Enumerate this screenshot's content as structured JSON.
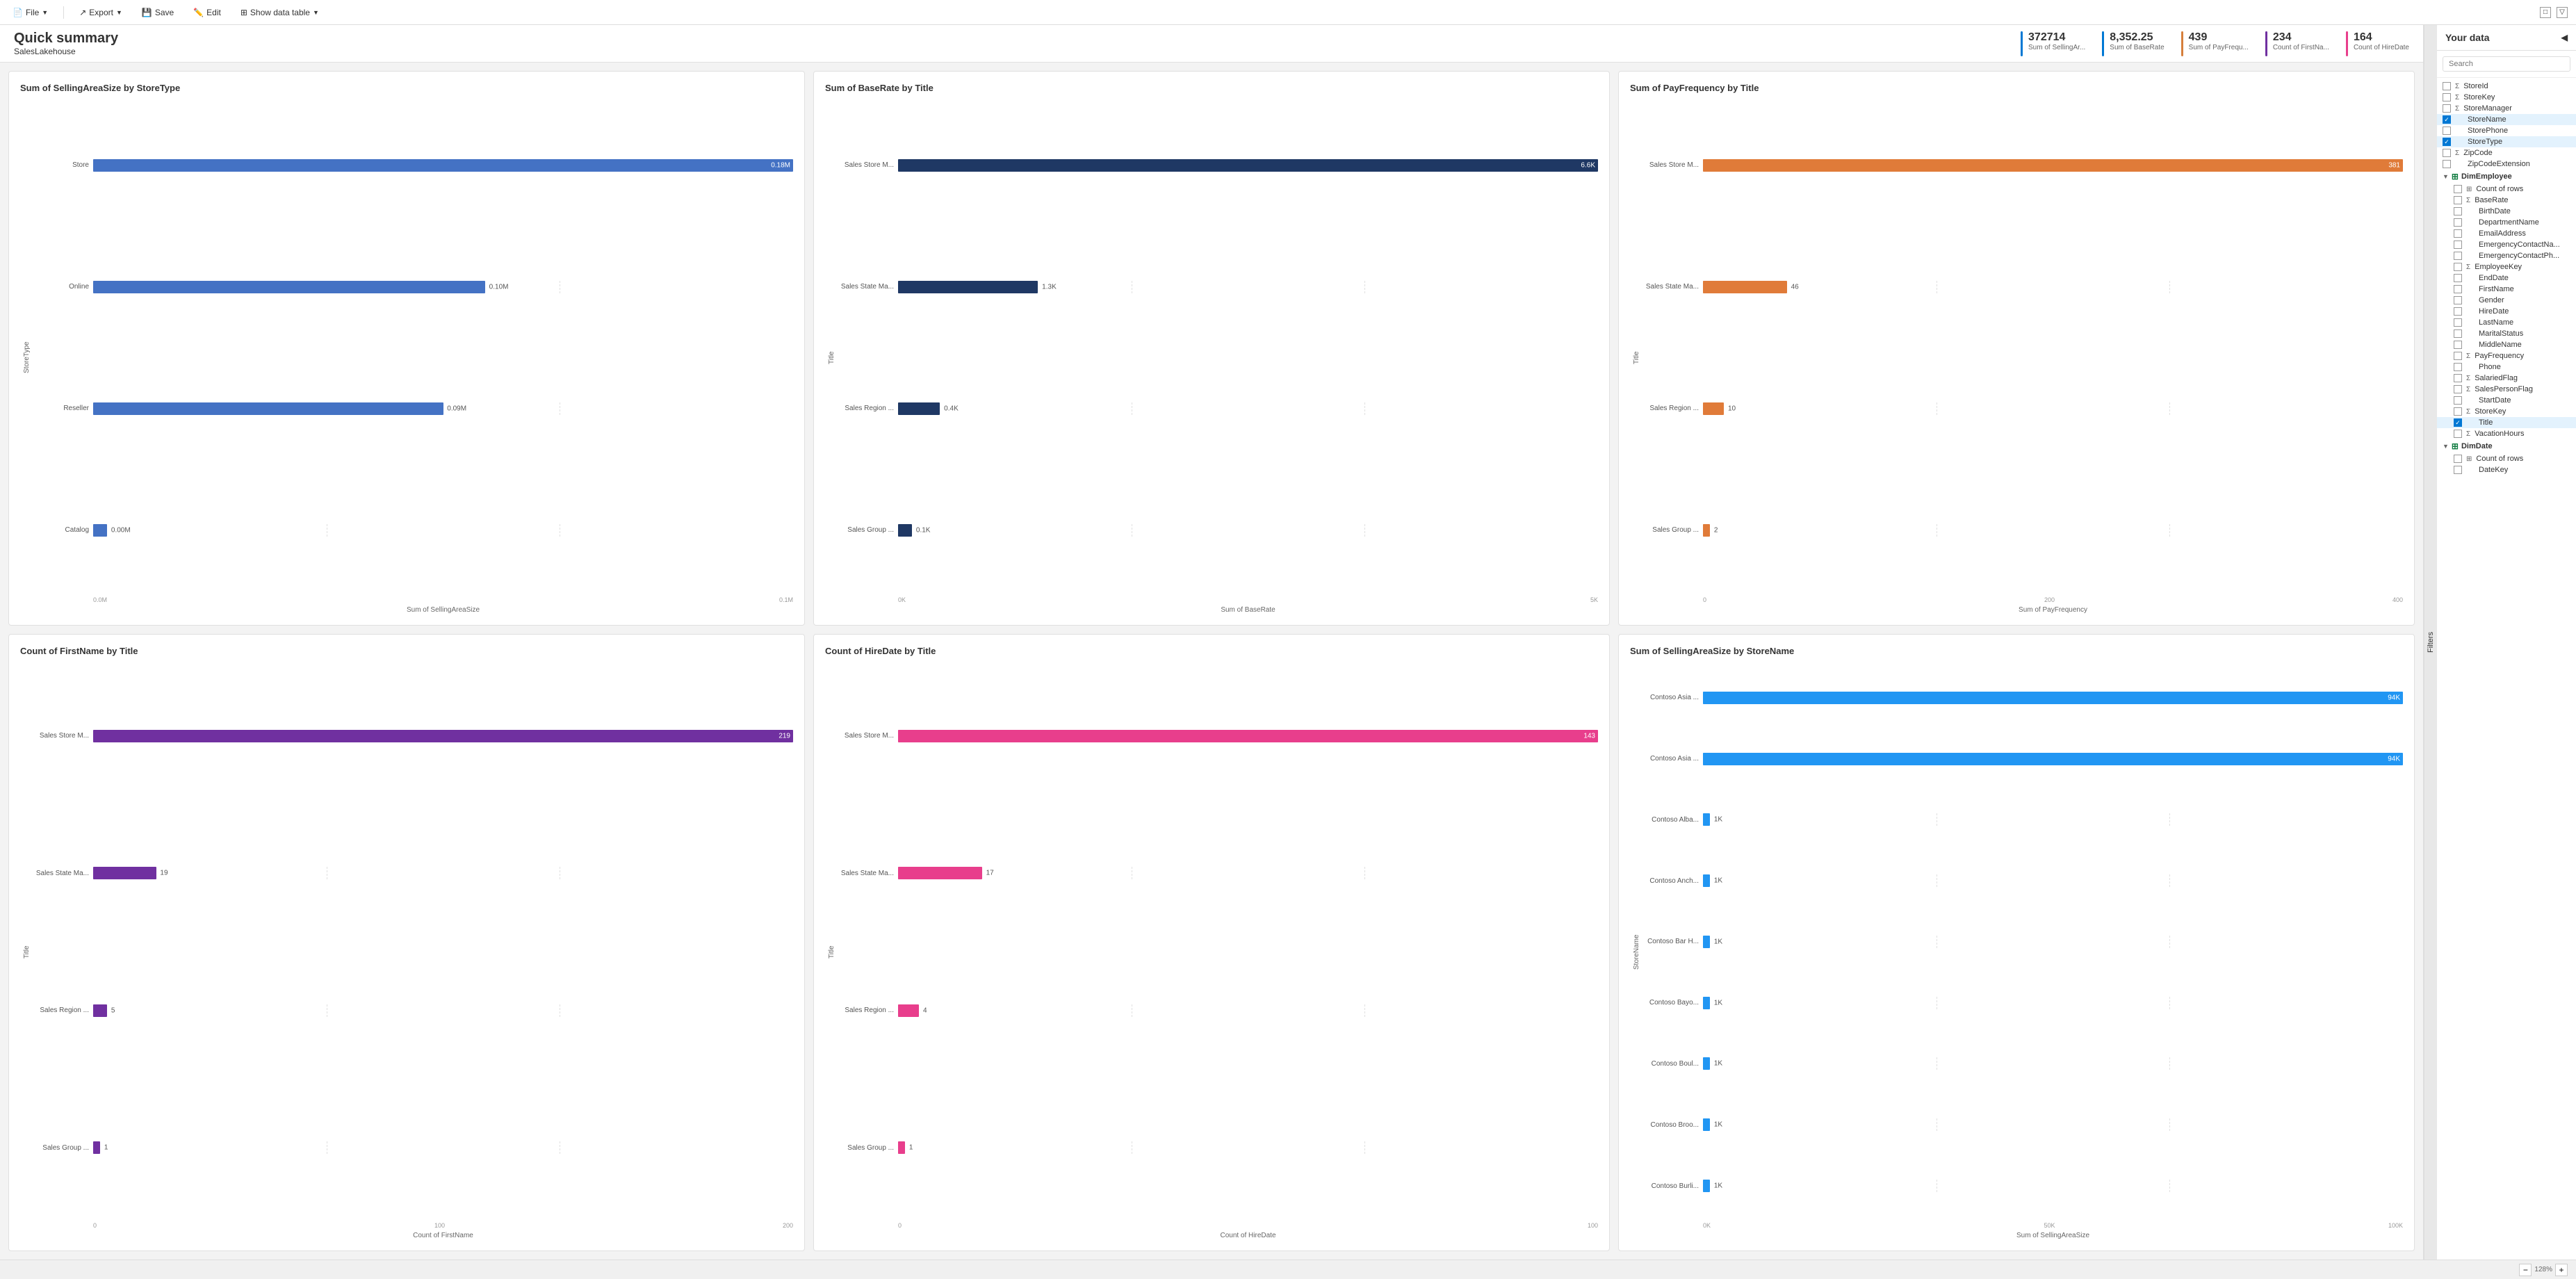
{
  "toolbar": {
    "file_label": "File",
    "export_label": "Export",
    "save_label": "Save",
    "edit_label": "Edit",
    "show_data_table_label": "Show data table"
  },
  "summary": {
    "title": "Quick summary",
    "subtitle": "SalesLakehouse",
    "kpis": [
      {
        "value": "372714",
        "label": "Sum of SellingAr...",
        "color": "#0078d4"
      },
      {
        "value": "8,352.25",
        "label": "Sum of BaseRate",
        "color": "#0078d4"
      },
      {
        "value": "439",
        "label": "Sum of PayFrequ...",
        "color": "#d67f3c"
      },
      {
        "value": "234",
        "label": "Count of FirstNa...",
        "color": "#7030a0"
      },
      {
        "value": "164",
        "label": "Count of HireDate",
        "color": "#e83e8c"
      }
    ]
  },
  "charts": [
    {
      "id": "chart1",
      "title": "Sum of SellingAreaSize by StoreType",
      "y_axis_label": "StoreType",
      "x_axis_label": "Sum of SellingAreaSize",
      "color": "#4472c4",
      "x_ticks": [
        "0.0M",
        "0.1M"
      ],
      "bars": [
        {
          "label": "Store",
          "value": "0.18M",
          "pct": 100
        },
        {
          "label": "Online",
          "value": "0.10M",
          "pct": 56
        },
        {
          "label": "Reseller",
          "value": "0.09M",
          "pct": 50
        },
        {
          "label": "Catalog",
          "value": "0.00M",
          "pct": 2
        }
      ]
    },
    {
      "id": "chart2",
      "title": "Sum of BaseRate by Title",
      "y_axis_label": "Title",
      "x_axis_label": "Sum of BaseRate",
      "color": "#1f3864",
      "x_ticks": [
        "0K",
        "5K"
      ],
      "bars": [
        {
          "label": "Sales Store M...",
          "value": "6.6K",
          "pct": 100
        },
        {
          "label": "Sales State Ma...",
          "value": "1.3K",
          "pct": 20
        },
        {
          "label": "Sales Region ...",
          "value": "0.4K",
          "pct": 6
        },
        {
          "label": "Sales Group ...",
          "value": "0.1K",
          "pct": 2
        }
      ]
    },
    {
      "id": "chart3",
      "title": "Sum of PayFrequency by Title",
      "y_axis_label": "Title",
      "x_axis_label": "Sum of PayFrequency",
      "color": "#e07b39",
      "x_ticks": [
        "0",
        "200",
        "400"
      ],
      "bars": [
        {
          "label": "Sales Store M...",
          "value": "381",
          "pct": 100
        },
        {
          "label": "Sales State Ma...",
          "value": "46",
          "pct": 12
        },
        {
          "label": "Sales Region ...",
          "value": "10",
          "pct": 3
        },
        {
          "label": "Sales Group ...",
          "value": "2",
          "pct": 1
        }
      ]
    },
    {
      "id": "chart4",
      "title": "Count of FirstName by Title",
      "y_axis_label": "Title",
      "x_axis_label": "Count of FirstName",
      "color": "#7030a0",
      "x_ticks": [
        "0",
        "100",
        "200"
      ],
      "bars": [
        {
          "label": "Sales Store M...",
          "value": "219",
          "pct": 100
        },
        {
          "label": "Sales State Ma...",
          "value": "19",
          "pct": 9
        },
        {
          "label": "Sales Region ...",
          "value": "5",
          "pct": 2
        },
        {
          "label": "Sales Group ...",
          "value": "1",
          "pct": 1
        }
      ]
    },
    {
      "id": "chart5",
      "title": "Count of HireDate by Title",
      "y_axis_label": "Title",
      "x_axis_label": "Count of HireDate",
      "color": "#e83e8c",
      "x_ticks": [
        "0",
        "100"
      ],
      "bars": [
        {
          "label": "Sales Store M...",
          "value": "143",
          "pct": 100
        },
        {
          "label": "Sales State Ma...",
          "value": "17",
          "pct": 12
        },
        {
          "label": "Sales Region ...",
          "value": "4",
          "pct": 3
        },
        {
          "label": "Sales Group ...",
          "value": "1",
          "pct": 1
        }
      ]
    },
    {
      "id": "chart6",
      "title": "Sum of SellingAreaSize by StoreName",
      "y_axis_label": "StoreName",
      "x_axis_label": "Sum of SellingAreaSize",
      "color": "#2196f3",
      "x_ticks": [
        "0K",
        "50K",
        "100K"
      ],
      "bars": [
        {
          "label": "Contoso Asia ...",
          "value": "94K",
          "pct": 100
        },
        {
          "label": "Contoso Asia ...",
          "value": "94K",
          "pct": 100
        },
        {
          "label": "Contoso Alba...",
          "value": "1K",
          "pct": 1
        },
        {
          "label": "Contoso Anch...",
          "value": "1K",
          "pct": 1
        },
        {
          "label": "Contoso Bar H...",
          "value": "1K",
          "pct": 1
        },
        {
          "label": "Contoso Bayo...",
          "value": "1K",
          "pct": 1
        },
        {
          "label": "Contoso Boul...",
          "value": "1K",
          "pct": 1
        },
        {
          "label": "Contoso Broo...",
          "value": "1K",
          "pct": 1
        },
        {
          "label": "Contoso Burli...",
          "value": "1K",
          "pct": 1
        }
      ]
    }
  ],
  "sidebar": {
    "title": "Your data",
    "search_placeholder": "Search",
    "filters_tab": "Filters",
    "tree": [
      {
        "type": "item",
        "label": "StoreId",
        "icon": "sigma",
        "checked": false
      },
      {
        "type": "item",
        "label": "StoreKey",
        "icon": "sigma",
        "checked": false
      },
      {
        "type": "item",
        "label": "StoreManager",
        "icon": "sigma",
        "checked": false
      },
      {
        "type": "item",
        "label": "StoreName",
        "icon": null,
        "checked": true,
        "selected": true
      },
      {
        "type": "item",
        "label": "StorePhone",
        "icon": null,
        "checked": false
      },
      {
        "type": "item",
        "label": "StoreType",
        "icon": null,
        "checked": true,
        "selected": true
      },
      {
        "type": "item",
        "label": "ZipCode",
        "icon": "sigma",
        "checked": false
      },
      {
        "type": "item",
        "label": "ZipCodeExtension",
        "icon": null,
        "checked": false
      },
      {
        "type": "group",
        "label": "DimEmployee",
        "icon": "table",
        "expanded": true
      },
      {
        "type": "item",
        "label": "Count of rows",
        "icon": "table-item",
        "checked": false,
        "indent": true
      },
      {
        "type": "item",
        "label": "BaseRate",
        "icon": "sigma",
        "checked": false,
        "indent": true
      },
      {
        "type": "item",
        "label": "BirthDate",
        "icon": null,
        "checked": false,
        "indent": true
      },
      {
        "type": "item",
        "label": "DepartmentName",
        "icon": null,
        "checked": false,
        "indent": true
      },
      {
        "type": "item",
        "label": "EmailAddress",
        "icon": null,
        "checked": false,
        "indent": true
      },
      {
        "type": "item",
        "label": "EmergencyContactNa...",
        "icon": null,
        "checked": false,
        "indent": true
      },
      {
        "type": "item",
        "label": "EmergencyContactPh...",
        "icon": null,
        "checked": false,
        "indent": true
      },
      {
        "type": "item",
        "label": "EmployeeKey",
        "icon": "sigma",
        "checked": false,
        "indent": true
      },
      {
        "type": "item",
        "label": "EndDate",
        "icon": null,
        "checked": false,
        "indent": true
      },
      {
        "type": "item",
        "label": "FirstName",
        "icon": null,
        "checked": false,
        "indent": true
      },
      {
        "type": "item",
        "label": "Gender",
        "icon": null,
        "checked": false,
        "indent": true
      },
      {
        "type": "item",
        "label": "HireDate",
        "icon": null,
        "checked": false,
        "indent": true
      },
      {
        "type": "item",
        "label": "LastName",
        "icon": null,
        "checked": false,
        "indent": true
      },
      {
        "type": "item",
        "label": "MaritalStatus",
        "icon": null,
        "checked": false,
        "indent": true
      },
      {
        "type": "item",
        "label": "MiddleName",
        "icon": null,
        "checked": false,
        "indent": true
      },
      {
        "type": "item",
        "label": "PayFrequency",
        "icon": "sigma",
        "checked": false,
        "indent": true
      },
      {
        "type": "item",
        "label": "Phone",
        "icon": null,
        "checked": false,
        "indent": true
      },
      {
        "type": "item",
        "label": "SalariedFlag",
        "icon": "sigma",
        "checked": false,
        "indent": true
      },
      {
        "type": "item",
        "label": "SalesPersonFlag",
        "icon": "sigma",
        "checked": false,
        "indent": true
      },
      {
        "type": "item",
        "label": "StartDate",
        "icon": null,
        "checked": false,
        "indent": true
      },
      {
        "type": "item",
        "label": "StoreKey",
        "icon": "sigma",
        "checked": false,
        "indent": true
      },
      {
        "type": "item",
        "label": "Title",
        "icon": null,
        "checked": true,
        "selected": true,
        "indent": true
      },
      {
        "type": "item",
        "label": "VacationHours",
        "icon": "sigma",
        "checked": false,
        "indent": true
      },
      {
        "type": "group",
        "label": "DimDate",
        "icon": "table",
        "expanded": true
      },
      {
        "type": "item",
        "label": "Count of rows",
        "icon": "table-item",
        "checked": false,
        "indent": true
      },
      {
        "type": "item",
        "label": "DateKey",
        "icon": null,
        "checked": false,
        "indent": true
      }
    ]
  },
  "bottom_bar": {
    "zoom_label": "128%"
  }
}
